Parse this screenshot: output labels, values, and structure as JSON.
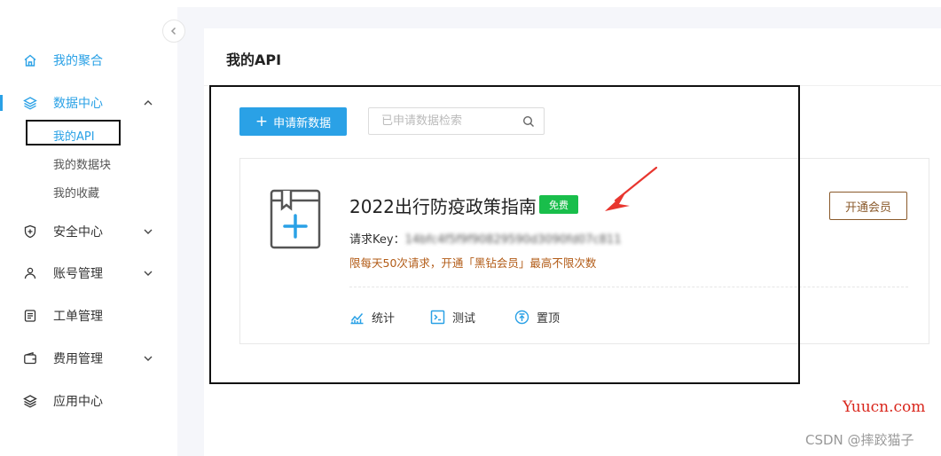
{
  "sidebar": {
    "collapse_icon": "chevron-left-icon",
    "items": [
      {
        "label": "我的聚合",
        "icon": "home-icon"
      },
      {
        "label": "数据中心",
        "icon": "layers-icon",
        "expanded": true,
        "children": [
          "我的API",
          "我的数据块",
          "我的收藏"
        ]
      },
      {
        "label": "安全中心",
        "icon": "shield-icon",
        "has_chevron": true
      },
      {
        "label": "账号管理",
        "icon": "user-icon",
        "has_chevron": true
      },
      {
        "label": "工单管理",
        "icon": "ticket-icon"
      },
      {
        "label": "费用管理",
        "icon": "wallet-icon",
        "has_chevron": true
      },
      {
        "label": "应用中心",
        "icon": "layers-icon"
      }
    ],
    "selected_child": "我的API"
  },
  "main": {
    "title": "我的API",
    "apply_button": "申请新数据",
    "search": {
      "placeholder": "已申请数据检索",
      "value": ""
    },
    "api_card": {
      "title": "2022出行防疫政策指南",
      "badge": "免费",
      "key_label": "请求Key：",
      "key_value": "14bfc4f5f9f90829590d3090fd07c811",
      "limit_note": "限每天50次请求，开通「黑钻会员」最高不限次数",
      "actions": [
        {
          "label": "统计",
          "icon": "chart-icon"
        },
        {
          "label": "测试",
          "icon": "terminal-icon"
        },
        {
          "label": "置顶",
          "icon": "pin-top-icon"
        }
      ],
      "member_button": "开通会员"
    }
  },
  "watermarks": {
    "site": "Yuucn.com",
    "csdn": "CSDN @摔跤猫子"
  },
  "colors": {
    "accent": "#2aa1e6",
    "badge": "#19be4b",
    "note": "#b25b16",
    "member": "#8a5a2b",
    "arrow": "#e8362f"
  }
}
